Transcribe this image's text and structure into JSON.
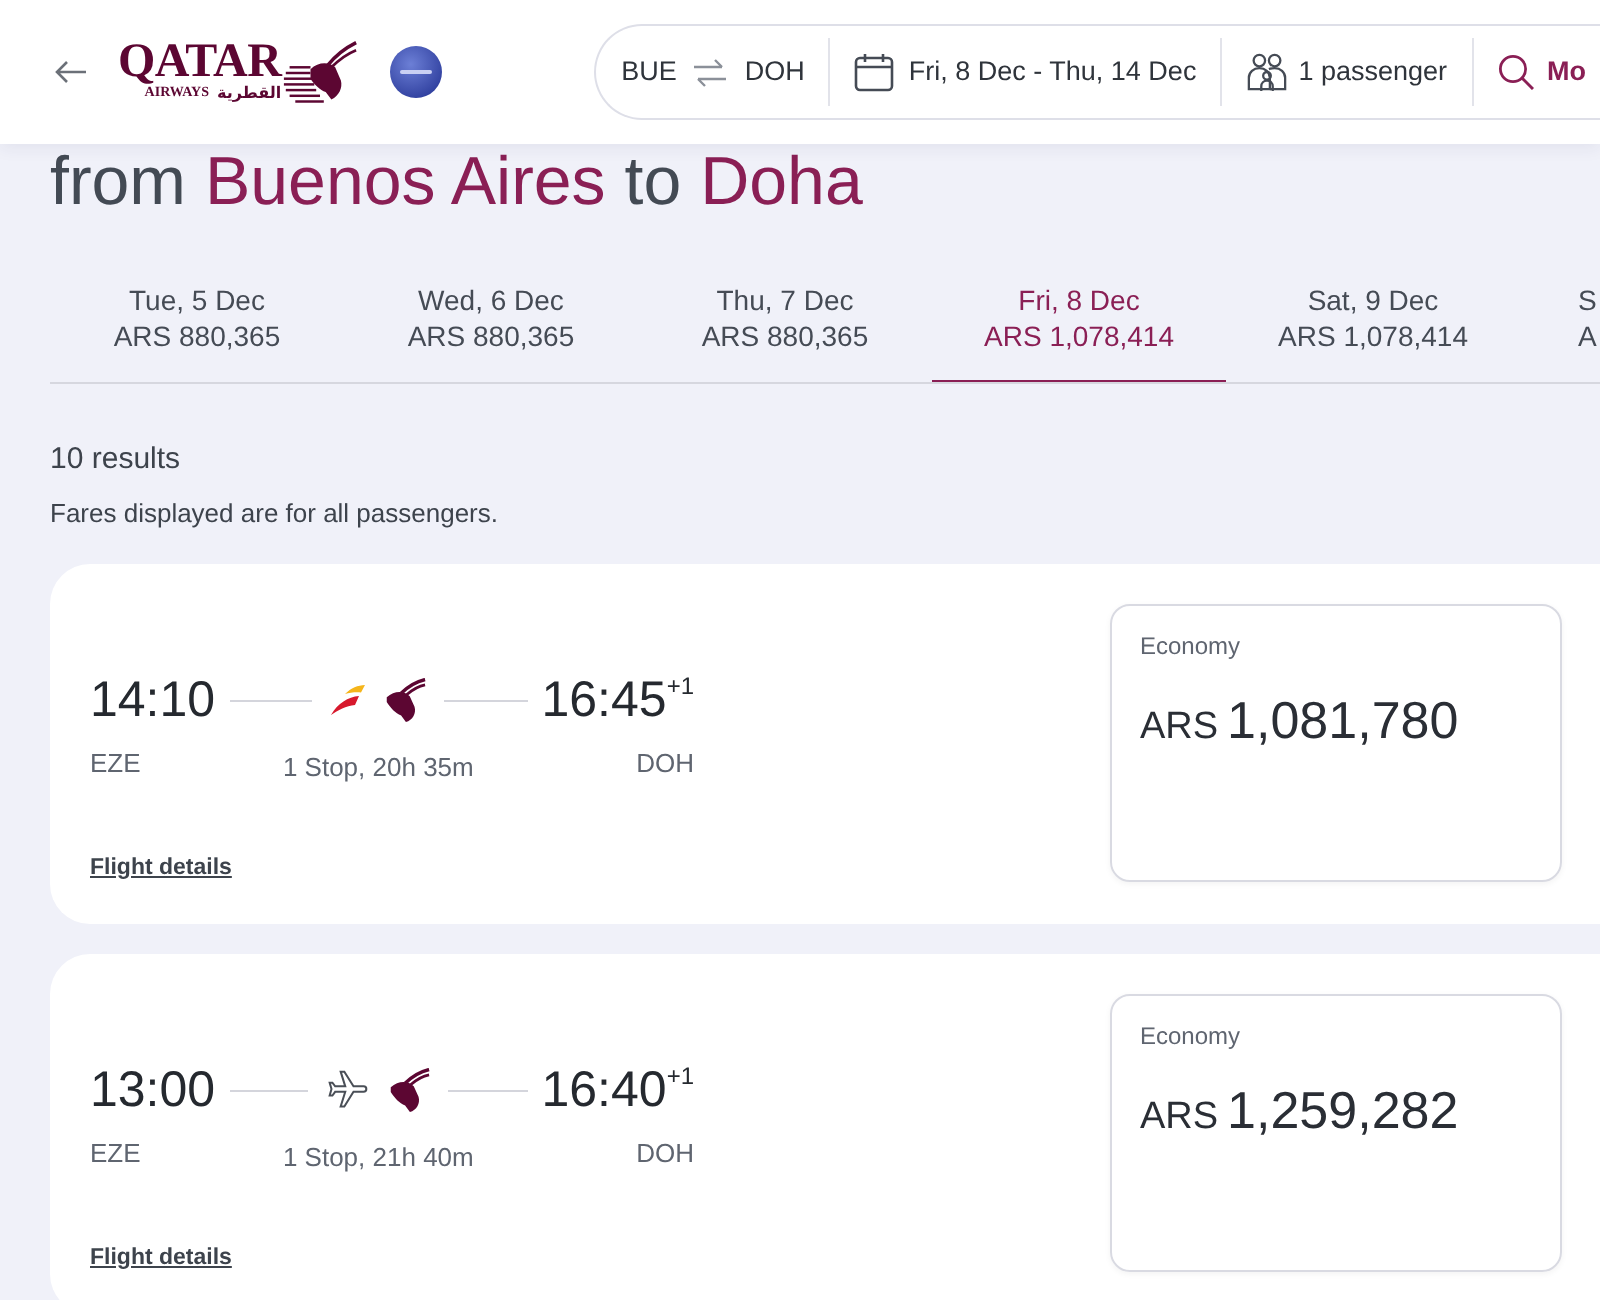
{
  "header": {
    "logo": {
      "wordmark": "QATAR",
      "subtitle": "AIRWAYS",
      "arabic": "القطرية"
    },
    "search_summary": {
      "origin": "BUE",
      "destination": "DOH",
      "dates": "Fri, 8 Dec - Thu, 14 Dec",
      "passengers": "1 passenger",
      "modify_label": "Mo"
    }
  },
  "heading": [
    {
      "text": "from",
      "kind": "plain"
    },
    {
      "text": "Buenos Aires",
      "kind": "city"
    },
    {
      "text": "to",
      "kind": "plain"
    },
    {
      "text": "Doha",
      "kind": "city"
    }
  ],
  "date_tabs": [
    {
      "date": "Tue, 5 Dec",
      "price": "ARS 880,365",
      "selected": false
    },
    {
      "date": "Wed, 6 Dec",
      "price": "ARS 880,365",
      "selected": false
    },
    {
      "date": "Thu, 7 Dec",
      "price": "ARS 880,365",
      "selected": false
    },
    {
      "date": "Fri, 8 Dec",
      "price": "ARS 1,078,414",
      "selected": true
    },
    {
      "date": "Sat, 9 Dec",
      "price": "ARS 1,078,414",
      "selected": false
    },
    {
      "date": "S",
      "price": "A",
      "selected": false
    }
  ],
  "results_count": "10 results",
  "fares_note": "Fares displayed are for all passengers.",
  "flights": [
    {
      "departure_time": "14:10",
      "arrival_time": "16:45$^{+1}$",
      "origin": "EZE",
      "destination": "DOH",
      "summary": "1 Stop, 20h 35m",
      "carriers": [
        {
          "kind": "swoosh"
        },
        {
          "kind": "oryx"
        }
      ],
      "details_link": "Flight details",
      "fare": {
        "cabin": "Economy",
        "currency": "ARS",
        "amount": "1,081,780"
      }
    },
    {
      "departure_time": "13:00",
      "arrival_time": "16:40$^{+1}$",
      "origin": "EZE",
      "destination": "DOH",
      "summary": "1 Stop, 21h 40m",
      "carriers": [
        {
          "kind": "plane"
        },
        {
          "kind": "oryx"
        }
      ],
      "details_link": "Flight details",
      "fare": {
        "cabin": "Economy",
        "currency": "ARS",
        "amount": "1,259,282"
      }
    }
  ]
}
